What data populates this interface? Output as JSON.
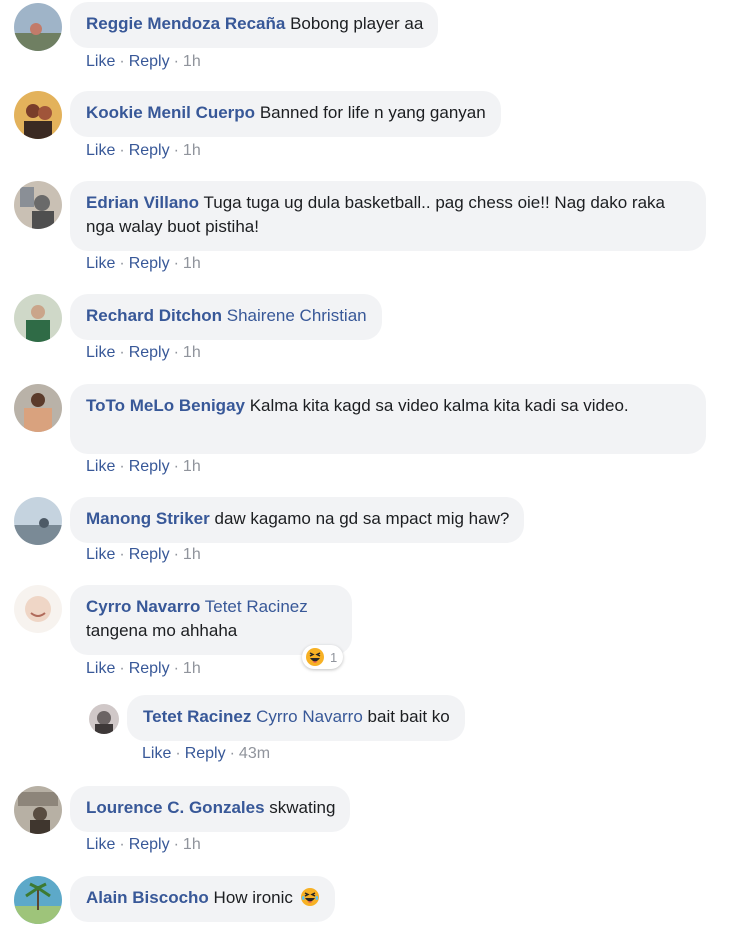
{
  "actions": {
    "like": "Like",
    "reply": "Reply",
    "separator": "·"
  },
  "comments": [
    {
      "author": "Reggie Mendoza Recaña",
      "mention": "",
      "text": "Bobong player aa",
      "time": "1h",
      "avatar_colors": [
        "#9fb4c8",
        "#6f7f62"
      ]
    },
    {
      "author": "Kookie Menil Cuerpo",
      "mention": "",
      "text": "Banned for life n yang ganyan",
      "time": "1h",
      "avatar_colors": [
        "#e3b25b",
        "#7a3d2a"
      ]
    },
    {
      "author": "Edrian Villano",
      "mention": "",
      "text": "Tuga tuga ug dula basketball.. pag chess oie!! Nag dako raka nga walay buot pistiha!",
      "time": "1h",
      "avatar_colors": [
        "#c9c0b4",
        "#6a6a6a"
      ]
    },
    {
      "author": "Rechard Ditchon",
      "mention": "Shairene Christian",
      "text": "",
      "time": "1h",
      "avatar_colors": [
        "#cfd8c8",
        "#2f6b46"
      ]
    },
    {
      "author": "ToTo MeLo Benigay",
      "mention": "",
      "text": "Kalma kita kagd sa video kalma kita kadi sa video.",
      "time": "1h",
      "avatar_colors": [
        "#d9a27e",
        "#5b3b2b"
      ]
    },
    {
      "author": "Manong Striker",
      "mention": "",
      "text": "daw kagamo na gd sa mpact mig haw?",
      "time": "1h",
      "avatar_colors": [
        "#c5d3df",
        "#4d5a66"
      ]
    },
    {
      "author": "Cyrro Navarro",
      "mention": "Tetet Racinez",
      "text": "tangena mo ahhaha",
      "time": "1h",
      "reaction_count": "1",
      "avatar_colors": [
        "#efd6c6",
        "#f7f3ef"
      ]
    },
    {
      "author": "Tetet Racinez",
      "mention": "Cyrro Navarro",
      "text": "bait bait ko",
      "time": "43m",
      "avatar_colors": [
        "#6b6464",
        "#d0c8c8"
      ]
    },
    {
      "author": "Lourence C. Gonzales",
      "mention": "",
      "text": "skwating",
      "time": "1h",
      "avatar_colors": [
        "#b7b0a4",
        "#594d41"
      ]
    },
    {
      "author": "Alain Biscocho",
      "mention": "",
      "text": "How ironic",
      "time": "",
      "avatar_colors": [
        "#5da9c9",
        "#9ec47a"
      ]
    }
  ]
}
